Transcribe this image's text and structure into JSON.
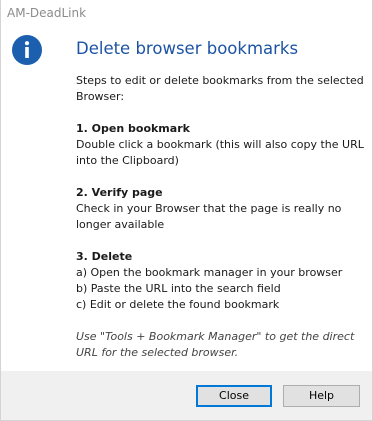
{
  "window": {
    "title": "AM-DeadLink"
  },
  "dialog": {
    "icon": "info-icon",
    "heading": "Delete browser bookmarks",
    "intro_line1": "Steps to edit or delete bookmarks from the selected",
    "intro_line2": "Browser:",
    "steps": [
      {
        "title": "1. Open bookmark",
        "lines": [
          "Double click a bookmark (this will also copy the URL",
          "into the Clipboard)"
        ]
      },
      {
        "title": "2. Verify page",
        "lines": [
          "Check in your Browser that the page is really no",
          "longer available"
        ]
      },
      {
        "title": "3. Delete",
        "lines": [
          "a) Open the bookmark manager in your browser",
          "b) Paste the URL into the search field",
          "c) Edit or delete the found bookmark"
        ]
      }
    ],
    "note_line1": "Use \"Tools + Bookmark Manager\" to get the direct",
    "note_line2": "URL for the selected browser."
  },
  "buttons": {
    "close_label": "Close",
    "help_label": "Help"
  },
  "colors": {
    "heading": "#1c53a4",
    "icon_circle": "#1c5fae",
    "footer_bg": "#f0f0f0",
    "default_button_border": "#0078d7"
  }
}
